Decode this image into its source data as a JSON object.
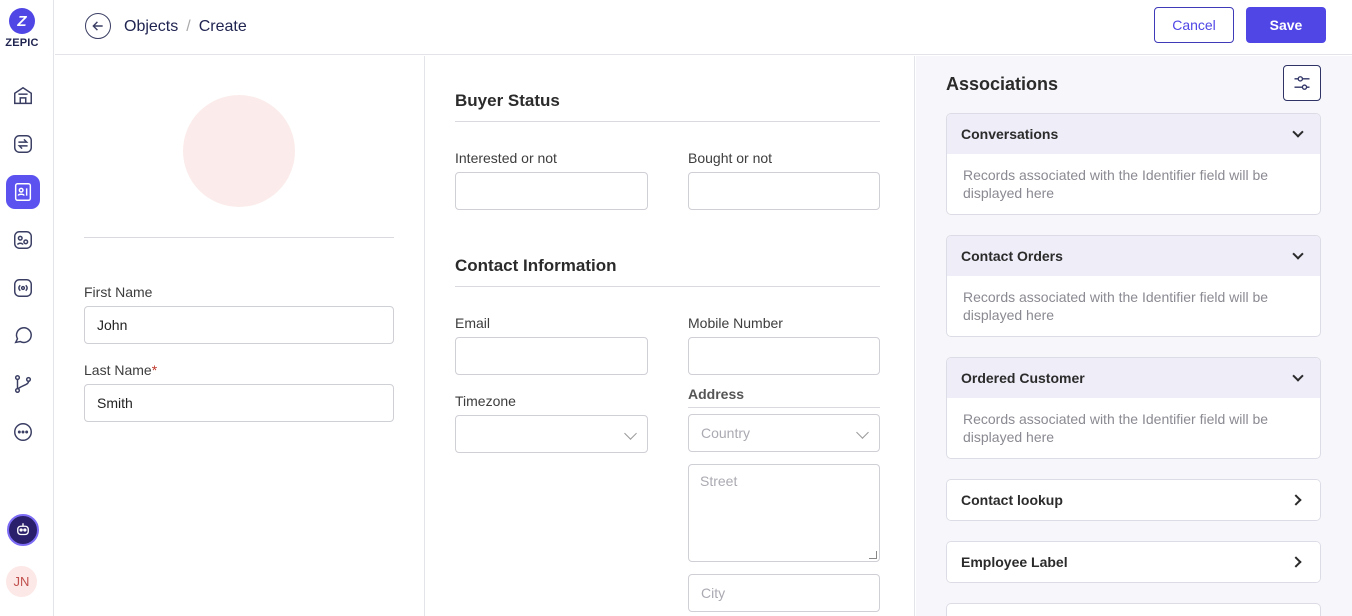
{
  "brand": {
    "logo_letter": "Z",
    "name": "ZEPIC"
  },
  "sidebar": {
    "items": [
      {
        "name": "home-icon"
      },
      {
        "name": "sync-icon"
      },
      {
        "name": "contacts-icon",
        "active": true
      },
      {
        "name": "segments-icon"
      },
      {
        "name": "broadcast-icon"
      },
      {
        "name": "chat-icon"
      },
      {
        "name": "flows-icon"
      },
      {
        "name": "more-icon"
      }
    ],
    "avatar_initials": "JN"
  },
  "header": {
    "breadcrumb": [
      "Objects",
      "Create"
    ],
    "separator": "/",
    "cancel_label": "Cancel",
    "save_label": "Save"
  },
  "profile": {
    "first_name_label": "First Name",
    "first_name_value": "John",
    "last_name_label": "Last Name",
    "last_name_required": "*",
    "last_name_value": "Smith"
  },
  "buyer_status": {
    "title": "Buyer Status",
    "interested_label": "Interested or not",
    "bought_label": "Bought or not"
  },
  "contact_info": {
    "title": "Contact Information",
    "email_label": "Email",
    "mobile_label": "Mobile Number",
    "timezone_label": "Timezone",
    "address_label": "Address",
    "country_placeholder": "Country",
    "street_placeholder": "Street",
    "city_placeholder": "City"
  },
  "associations": {
    "title": "Associations",
    "cards": [
      {
        "title": "Conversations",
        "expanded": true,
        "body": "Records associated with the Identifier field will be displayed here"
      },
      {
        "title": "Contact Orders",
        "expanded": true,
        "body": "Records associated with the Identifier field will be displayed here"
      },
      {
        "title": "Ordered Customer",
        "expanded": true,
        "body": "Records associated with the Identifier field will be displayed here"
      },
      {
        "title": "Contact lookup",
        "expanded": false
      },
      {
        "title": "Employee Label",
        "expanded": false
      }
    ]
  },
  "colors": {
    "accent": "#4f46e5",
    "avatar_bg": "#fbeceb",
    "card_head": "#efedf8"
  }
}
